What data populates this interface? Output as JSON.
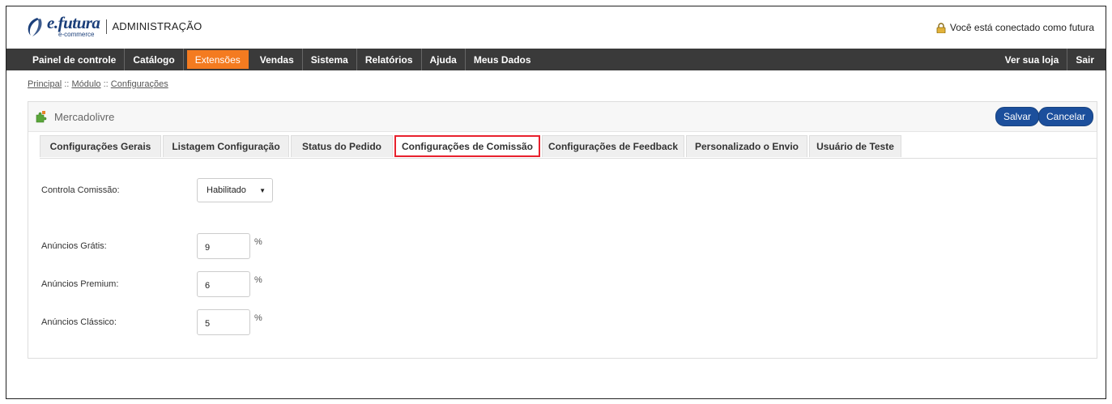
{
  "header": {
    "brand_prefix": "e.",
    "brand_name": "futura",
    "brand_sub": "e-commerce",
    "admin_title": "ADMINISTRAÇÃO",
    "connected_text": "Você está conectado como futura"
  },
  "nav": {
    "items": [
      "Painel de controle",
      "Catálogo",
      "Extensões",
      "Vendas",
      "Sistema",
      "Relatórios",
      "Ajuda",
      "Meus Dados"
    ],
    "active_index": 2,
    "right_items": [
      "Ver sua loja",
      "Sair"
    ],
    "active_color": "#f47b20"
  },
  "breadcrumb": {
    "items": [
      "Principal",
      "Módulo",
      "Configurações"
    ],
    "separator": "::"
  },
  "panel": {
    "title": "Mercadolivre",
    "save_label": "Salvar",
    "cancel_label": "Cancelar",
    "icon": "puzzle-icon"
  },
  "tabs": [
    "Configurações Gerais",
    "Listagem Configuração",
    "Status do Pedido",
    "Configurações de Comissão",
    "Configurações de Feedback",
    "Personalizado o Envio",
    "Usuário de Teste"
  ],
  "current_tab_index": 3,
  "form": {
    "controla_label": "Controla Comissão:",
    "controla_value": "Habilitado",
    "gratis_label": "Anúncios Grátis:",
    "gratis_value": "9",
    "premium_label": "Anúncios Premium:",
    "premium_value": "6",
    "classico_label": "Anúncios Clássico:",
    "classico_value": "5",
    "unit": "%"
  }
}
